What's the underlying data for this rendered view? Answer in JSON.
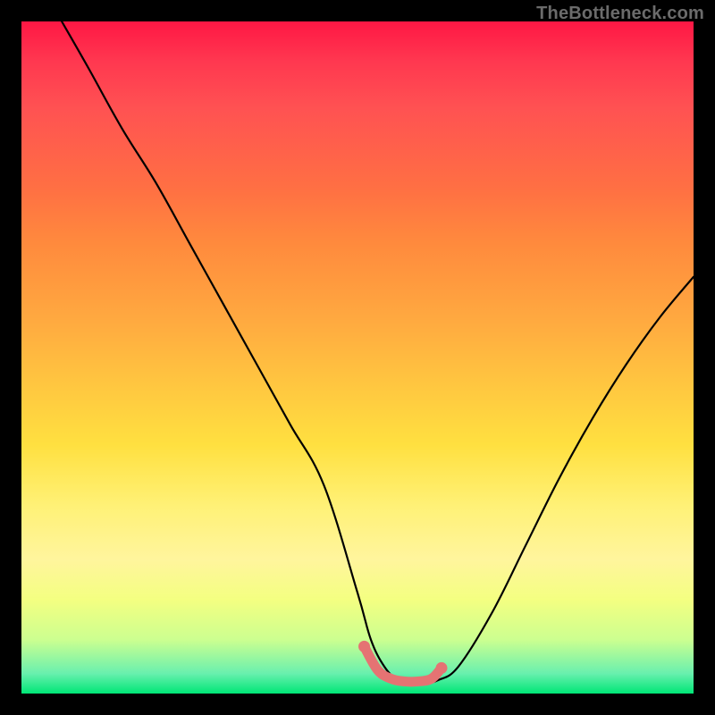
{
  "watermark": "TheBottleneck.com",
  "chart_data": {
    "type": "line",
    "title": "",
    "xlabel": "",
    "ylabel": "",
    "xlim": [
      0,
      100
    ],
    "ylim": [
      0,
      100
    ],
    "grid": false,
    "series": [
      {
        "name": "bottleneck-curve",
        "color": "#000000",
        "x": [
          6,
          10,
          15,
          20,
          25,
          30,
          35,
          40,
          45,
          50,
          52,
          54,
          56,
          58,
          60,
          62,
          65,
          70,
          75,
          80,
          85,
          90,
          95,
          100
        ],
        "y": [
          100,
          93,
          84,
          76,
          67,
          58,
          49,
          40,
          31,
          15,
          8,
          4,
          2,
          1.5,
          1.5,
          2,
          4,
          12,
          22,
          32,
          41,
          49,
          56,
          62
        ]
      },
      {
        "name": "optimal-range",
        "color": "#e57373",
        "x": [
          51,
          53,
          55,
          57,
          59,
          61,
          62.5
        ],
        "y": [
          7,
          3.5,
          2.2,
          1.8,
          1.8,
          2.2,
          3.8
        ]
      }
    ],
    "annotations": []
  },
  "colors": {
    "background_frame": "#000000",
    "gradient_top": "#ff1744",
    "gradient_bottom": "#00e676",
    "curve": "#000000",
    "optimal_marker": "#e57373",
    "watermark": "#6b6b6b"
  }
}
